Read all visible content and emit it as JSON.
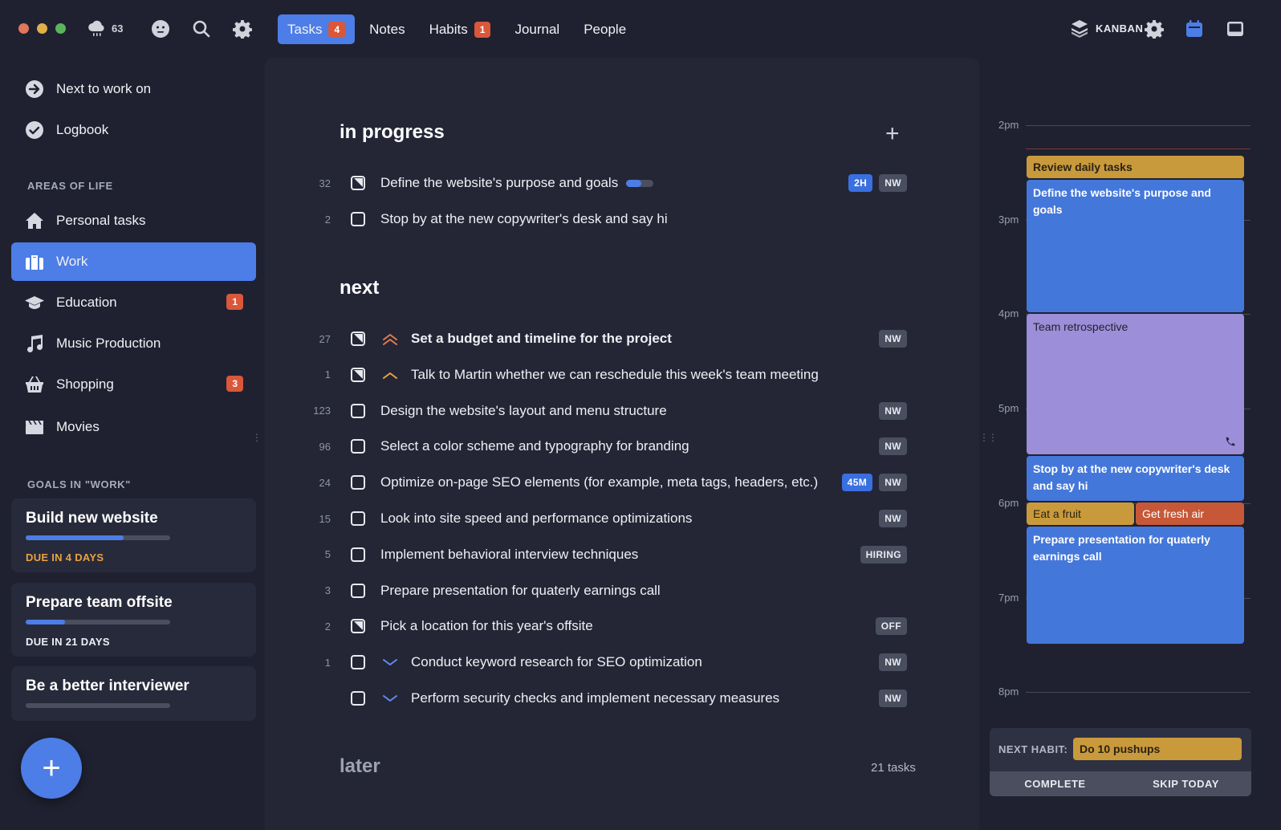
{
  "topbar": {
    "weather_temp": "63",
    "tabs": [
      {
        "label": "Tasks",
        "badge": "4"
      },
      {
        "label": "Notes"
      },
      {
        "label": "Habits",
        "badge": "1"
      },
      {
        "label": "Journal"
      },
      {
        "label": "People"
      }
    ],
    "view_mode": "KANBAN"
  },
  "sidebar": {
    "items": [
      {
        "label": "Next to work on",
        "icon": "arrow-right-circle-icon"
      },
      {
        "label": "Logbook",
        "icon": "check-circle-icon"
      }
    ],
    "areas_heading": "AREAS OF LIFE",
    "areas": [
      {
        "label": "Personal tasks",
        "icon": "home-icon"
      },
      {
        "label": "Work",
        "icon": "briefcase-icon"
      },
      {
        "label": "Education",
        "icon": "graduation-cap-icon",
        "badge": "1"
      },
      {
        "label": "Music Production",
        "icon": "music-note-icon"
      },
      {
        "label": "Shopping",
        "icon": "basket-icon",
        "badge": "3"
      },
      {
        "label": "Movies",
        "icon": "clapperboard-icon"
      }
    ],
    "goals_heading": "GOALS IN \"WORK\"",
    "goals": [
      {
        "title": "Build new website",
        "due": "DUE IN 4 DAYS",
        "progress": 0.68
      },
      {
        "title": "Prepare team offsite",
        "due": "DUE IN 21 DAYS",
        "progress": 0.27
      },
      {
        "title": "Be a better interviewer",
        "due": "",
        "progress": 0
      }
    ],
    "add_button": "+"
  },
  "main": {
    "in_progress_title": "in progress",
    "add_icon": "+",
    "in_progress": [
      {
        "num": "32",
        "label": "Define the website's purpose and goals",
        "checked": "half",
        "progress": 0.55,
        "tags": [
          "2H",
          "NW"
        ]
      },
      {
        "num": "2",
        "label": "Stop by at the new copywriter's desk and say hi",
        "checked": "none",
        "tags": []
      }
    ],
    "next_title": "next",
    "next": [
      {
        "num": "27",
        "label": "Set a budget and timeline for the project",
        "checked": "half",
        "priority": "high",
        "tags": [
          "NW"
        ]
      },
      {
        "num": "1",
        "label": "Talk to Martin whether we can reschedule this week's team meeting",
        "checked": "half",
        "priority": "medium",
        "tags": []
      },
      {
        "num": "123",
        "label": "Design the website's layout and menu structure",
        "checked": "none",
        "tags": [
          "NW"
        ]
      },
      {
        "num": "96",
        "label": "Select a color scheme and typography for branding",
        "checked": "none",
        "tags": [
          "NW"
        ]
      },
      {
        "num": "24",
        "label": "Optimize on-page SEO elements (for example, meta tags, headers, etc.)",
        "checked": "none",
        "tags": [
          "45M",
          "NW"
        ]
      },
      {
        "num": "15",
        "label": "Look into site speed and performance optimizations",
        "checked": "none",
        "tags": [
          "NW"
        ]
      },
      {
        "num": "5",
        "label": "Implement behavioral interview techniques",
        "checked": "none",
        "tags": [
          "HIRING"
        ]
      },
      {
        "num": "3",
        "label": "Prepare presentation for quaterly earnings call",
        "checked": "none",
        "tags": []
      },
      {
        "num": "2",
        "label": "Pick a location for this year's offsite",
        "checked": "half",
        "tags": [
          "OFF"
        ]
      },
      {
        "num": "1",
        "label": "Conduct keyword research for SEO optimization",
        "checked": "none",
        "priority": "low",
        "tags": [
          "NW"
        ]
      },
      {
        "num": "",
        "label": "Perform security checks and implement necessary measures",
        "checked": "none",
        "priority": "low",
        "tags": [
          "NW"
        ]
      }
    ],
    "later_title": "later",
    "later_count": "21 tasks"
  },
  "calendar": {
    "hours": [
      "2pm",
      "3pm",
      "4pm",
      "5pm",
      "6pm",
      "7pm",
      "8pm"
    ],
    "events": [
      {
        "title": "Review daily tasks",
        "color": "#c99a3c"
      },
      {
        "title": "Define the website's purpose and goals",
        "color": "#4477da"
      },
      {
        "title": "Team retrospective",
        "color": "#9c8ed8"
      },
      {
        "title": "Stop by at the new copywriter's desk and say hi",
        "color": "#4477da"
      },
      {
        "title": "Eat a fruit",
        "color": "#c99a3c"
      },
      {
        "title": "Get fresh air",
        "color": "#c65838"
      },
      {
        "title": "Prepare presentation for quaterly earnings call",
        "color": "#4477da"
      }
    ],
    "habit": {
      "label": "NEXT HABIT:",
      "name": "Do 10 pushups",
      "complete": "COMPLETE",
      "skip": "SKIP TODAY"
    }
  },
  "colors": {
    "accent": "#4d7de6",
    "badge": "#d9573a",
    "gold": "#c99a3c",
    "purple": "#9c8ed8",
    "background": "#1f2130"
  }
}
